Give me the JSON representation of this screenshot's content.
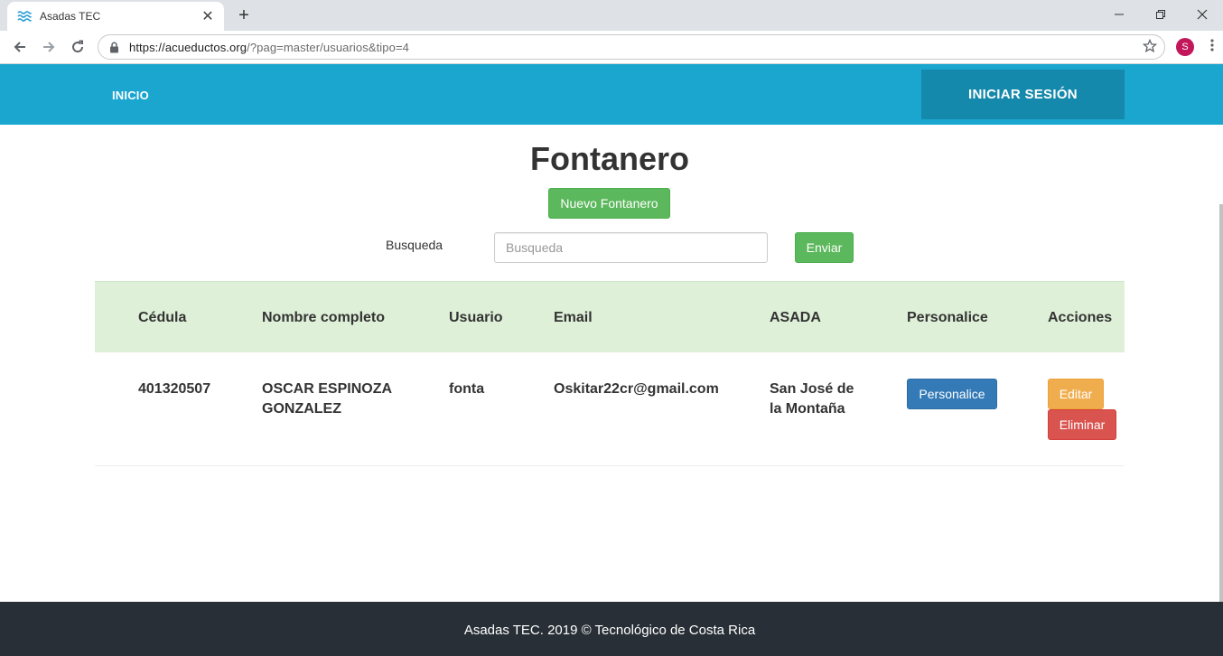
{
  "browser": {
    "tab_title": "Asadas TEC",
    "tab_close": "✕",
    "new_tab": "+",
    "url_host": "https://acueductos.org",
    "url_path": "/?pag=master/usuarios&tipo=4",
    "profile_initial": "S"
  },
  "nav": {
    "home_label": "INICIO",
    "login_label": "INICIAR SESIÓN"
  },
  "main": {
    "title": "Fontanero",
    "new_button": "Nuevo Fontanero",
    "search_label": "Busqueda",
    "search_placeholder": "Busqueda",
    "send_button": "Enviar"
  },
  "table": {
    "headers": {
      "cedula": "Cédula",
      "nombre": "Nombre completo",
      "usuario": "Usuario",
      "email": "Email",
      "asada": "ASADA",
      "personalice": "Personalice",
      "acciones": "Acciones"
    },
    "rows": [
      {
        "cedula": "401320507",
        "nombre_1": "OSCAR ESPINOZA",
        "nombre_2": "GONZALEZ",
        "usuario": "fonta",
        "email": "Oskitar22cr@gmail.com",
        "asada_1": "San José de",
        "asada_2": "la Montaña",
        "personalice_button": "Personalice",
        "edit_button": "Editar",
        "delete_button": "Eliminar"
      }
    ]
  },
  "footer": {
    "text": "Asadas TEC. 2019 © Tecnológico de Costa Rica"
  },
  "colors": {
    "nav_bg": "#1aa6cf",
    "nav_login_bg": "#1589ab",
    "table_head_bg": "#dff0d8",
    "footer_bg": "#282f36",
    "success": "#5cb85c",
    "primary": "#337ab7",
    "warning": "#f0ad4e",
    "danger": "#d9534f"
  },
  "icons": {
    "favicon": "waves-icon",
    "back": "arrow-left-icon",
    "forward": "arrow-right-icon",
    "reload": "reload-icon",
    "lock": "lock-icon",
    "bookmark": "star-icon",
    "menu": "kebab-menu-icon"
  }
}
